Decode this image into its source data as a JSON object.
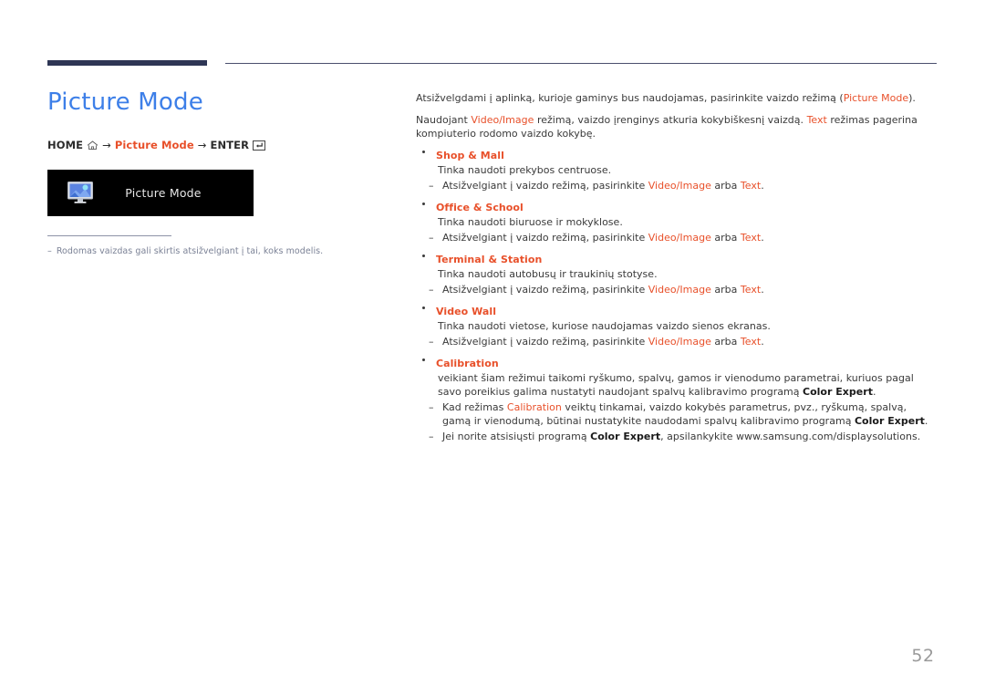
{
  "header": {
    "accent_bar_color": "#2e3655",
    "rule_color": "#4a4f6d"
  },
  "left": {
    "page_title": "Picture Mode",
    "title_color": "#3d7fe8",
    "breadcrumb": {
      "home_label": "HOME",
      "home_icon": "home-icon",
      "arrow1": "→",
      "menu_label": "Picture Mode",
      "arrow2": "→",
      "enter_label": "ENTER",
      "enter_icon": "enter-key-icon",
      "accent_color": "#e8502a"
    },
    "osd": {
      "icon": "picture-mode-monitor-icon",
      "label": "Picture Mode",
      "background": "#000000",
      "text_color": "#e6e6e6"
    },
    "note": {
      "dash": "–",
      "text": "Rodomas vaizdas gali skirtis atsižvelgiant į tai, koks modelis.",
      "color": "#7b8296"
    }
  },
  "right": {
    "intro_1": {
      "pre": "Atsižvelgdami į aplinką, kurioje gaminys bus naudojamas, pasirinkite vaizdo režimą (",
      "accent": "Picture Mode",
      "post": ")."
    },
    "intro_2": {
      "t1": "Naudojant ",
      "a1": "Video/Image",
      "t2": " režimą, vaizdo įrenginys atkuria kokybiškesnį vaizdą. ",
      "a2": "Text",
      "t3": " režimas pagerina kompiuterio rodomo vaizdo kokybę."
    },
    "sub_common": {
      "pre": "Atsižvelgiant į vaizdo režimą, pasirinkite ",
      "a1": "Video/Image",
      "mid": " arba ",
      "a2": "Text",
      "post": "."
    },
    "bullets": [
      {
        "label": "Shop & Mall",
        "desc": "Tinka naudoti prekybos centruose.",
        "sub_type": "common"
      },
      {
        "label": "Office & School",
        "desc": "Tinka naudoti biuruose ir mokyklose.",
        "sub_type": "common"
      },
      {
        "label": "Terminal & Station",
        "desc": "Tinka naudoti autobusų ir traukinių stotyse.",
        "sub_type": "common"
      },
      {
        "label": "Video Wall",
        "desc": "Tinka naudoti vietose, kuriose naudojamas vaizdo sienos ekranas.",
        "sub_type": "common"
      },
      {
        "label": "Calibration",
        "sub_type": "calibration"
      }
    ],
    "calibration": {
      "desc_pre": "veikiant šiam režimui taikomi ryškumo, spalvų, gamos ir vienodumo parametrai, kuriuos pagal savo poreikius galima nustatyti naudojant spalvų kalibravimo programą ",
      "desc_bold": "Color Expert",
      "desc_post": ".",
      "sub1": {
        "t1": "Kad režimas ",
        "a1": "Calibration",
        "t2": " veiktų tinkamai, vaizdo kokybės parametrus, pvz., ryškumą, spalvą, gamą ir vienodumą, būtinai nustatykite naudodami spalvų kalibravimo programą ",
        "b1": "Color Expert",
        "t3": "."
      },
      "sub2": {
        "t1": "Jei norite atsisiųsti programą ",
        "b1": "Color Expert",
        "t2": ", apsilankykite www.samsung.com/displaysolutions."
      }
    },
    "dash": "–",
    "accent_color": "#e8502a"
  },
  "footer": {
    "page_number": "52"
  }
}
